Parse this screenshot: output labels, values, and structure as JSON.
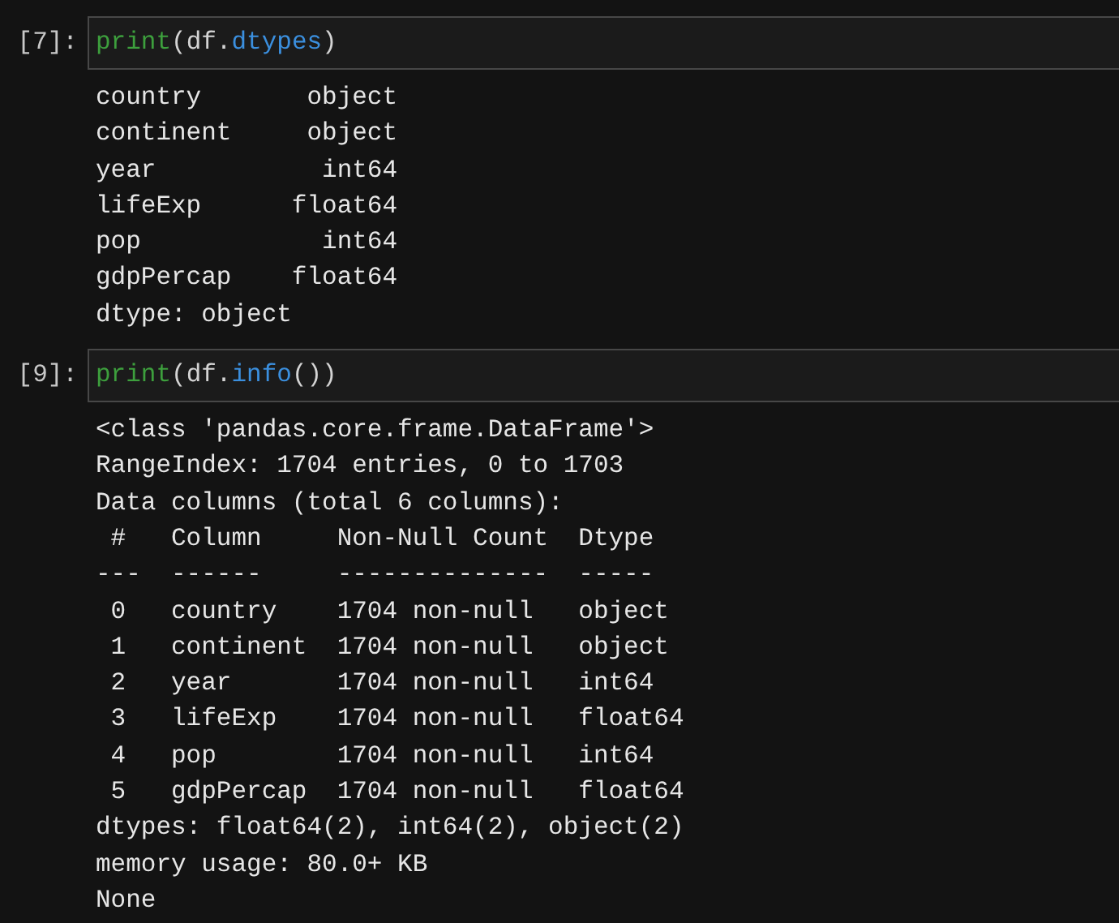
{
  "cells": [
    {
      "prompt": "[7]:",
      "input": [
        {
          "kind": "builtin",
          "text": "print"
        },
        {
          "kind": "plain",
          "text": "(df."
        },
        {
          "kind": "attr",
          "text": "dtypes"
        },
        {
          "kind": "plain",
          "text": ")"
        }
      ],
      "output": [
        "country       object",
        "continent     object",
        "year           int64",
        "lifeExp      float64",
        "pop            int64",
        "gdpPercap    float64",
        "dtype: object"
      ]
    },
    {
      "prompt": "[9]:",
      "input": [
        {
          "kind": "builtin",
          "text": "print"
        },
        {
          "kind": "plain",
          "text": "(df."
        },
        {
          "kind": "attr",
          "text": "info"
        },
        {
          "kind": "plain",
          "text": "())"
        }
      ],
      "output": [
        "<class 'pandas.core.frame.DataFrame'>",
        "RangeIndex: 1704 entries, 0 to 1703",
        "Data columns (total 6 columns):",
        " #   Column     Non-Null Count  Dtype",
        "---  ------     --------------  -----",
        " 0   country    1704 non-null   object",
        " 1   continent  1704 non-null   object",
        " 2   year       1704 non-null   int64",
        " 3   lifeExp    1704 non-null   float64",
        " 4   pop        1704 non-null   int64",
        " 5   gdpPercap  1704 non-null   float64",
        "dtypes: float64(2), int64(2), object(2)",
        "memory usage: 80.0+ KB",
        "None"
      ]
    }
  ]
}
